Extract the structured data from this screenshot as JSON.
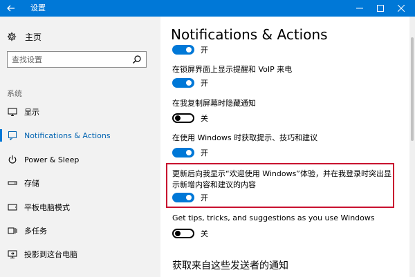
{
  "window": {
    "title": "设置"
  },
  "sidebar": {
    "home_label": "主页",
    "search_placeholder": "查找设置",
    "section_label": "系统",
    "items": [
      {
        "label": "显示",
        "icon": "monitor-icon"
      },
      {
        "label": "Notifications & Actions",
        "icon": "notification-icon",
        "selected": true
      },
      {
        "label": "Power & Sleep",
        "icon": "power-icon"
      },
      {
        "label": "存储",
        "icon": "storage-icon"
      },
      {
        "label": "平板电脑模式",
        "icon": "tablet-icon"
      },
      {
        "label": "多任务",
        "icon": "multitask-icon"
      },
      {
        "label": "投影到这台电脑",
        "icon": "project-icon"
      }
    ]
  },
  "main": {
    "title": "Notifications & Actions",
    "settings": [
      {
        "label": "",
        "state": "开",
        "on": true
      },
      {
        "label": "在锁屏界面上显示提醒和 VoIP 来电",
        "state": "开",
        "on": true
      },
      {
        "label": "在我复制屏幕时隐藏通知",
        "state": "关",
        "on": false
      },
      {
        "label": "在使用 Windows 时获取提示、技巧和建议",
        "state": "开",
        "on": true
      },
      {
        "label": "更新后向我显示“欢迎使用 Windows”体验，并在我登录时突出显示新增内容和建议的内容",
        "state": "开",
        "on": true,
        "highlighted": true
      },
      {
        "label": "Get tips, tricks, and suggestions as you use Windows",
        "state": "关",
        "on": false
      }
    ],
    "section_heading": "获取来自这些发送者的通知"
  },
  "colors": {
    "accent": "#0078d7",
    "highlight_border": "#c8102e",
    "sidebar_bg": "#f2f2f2"
  }
}
